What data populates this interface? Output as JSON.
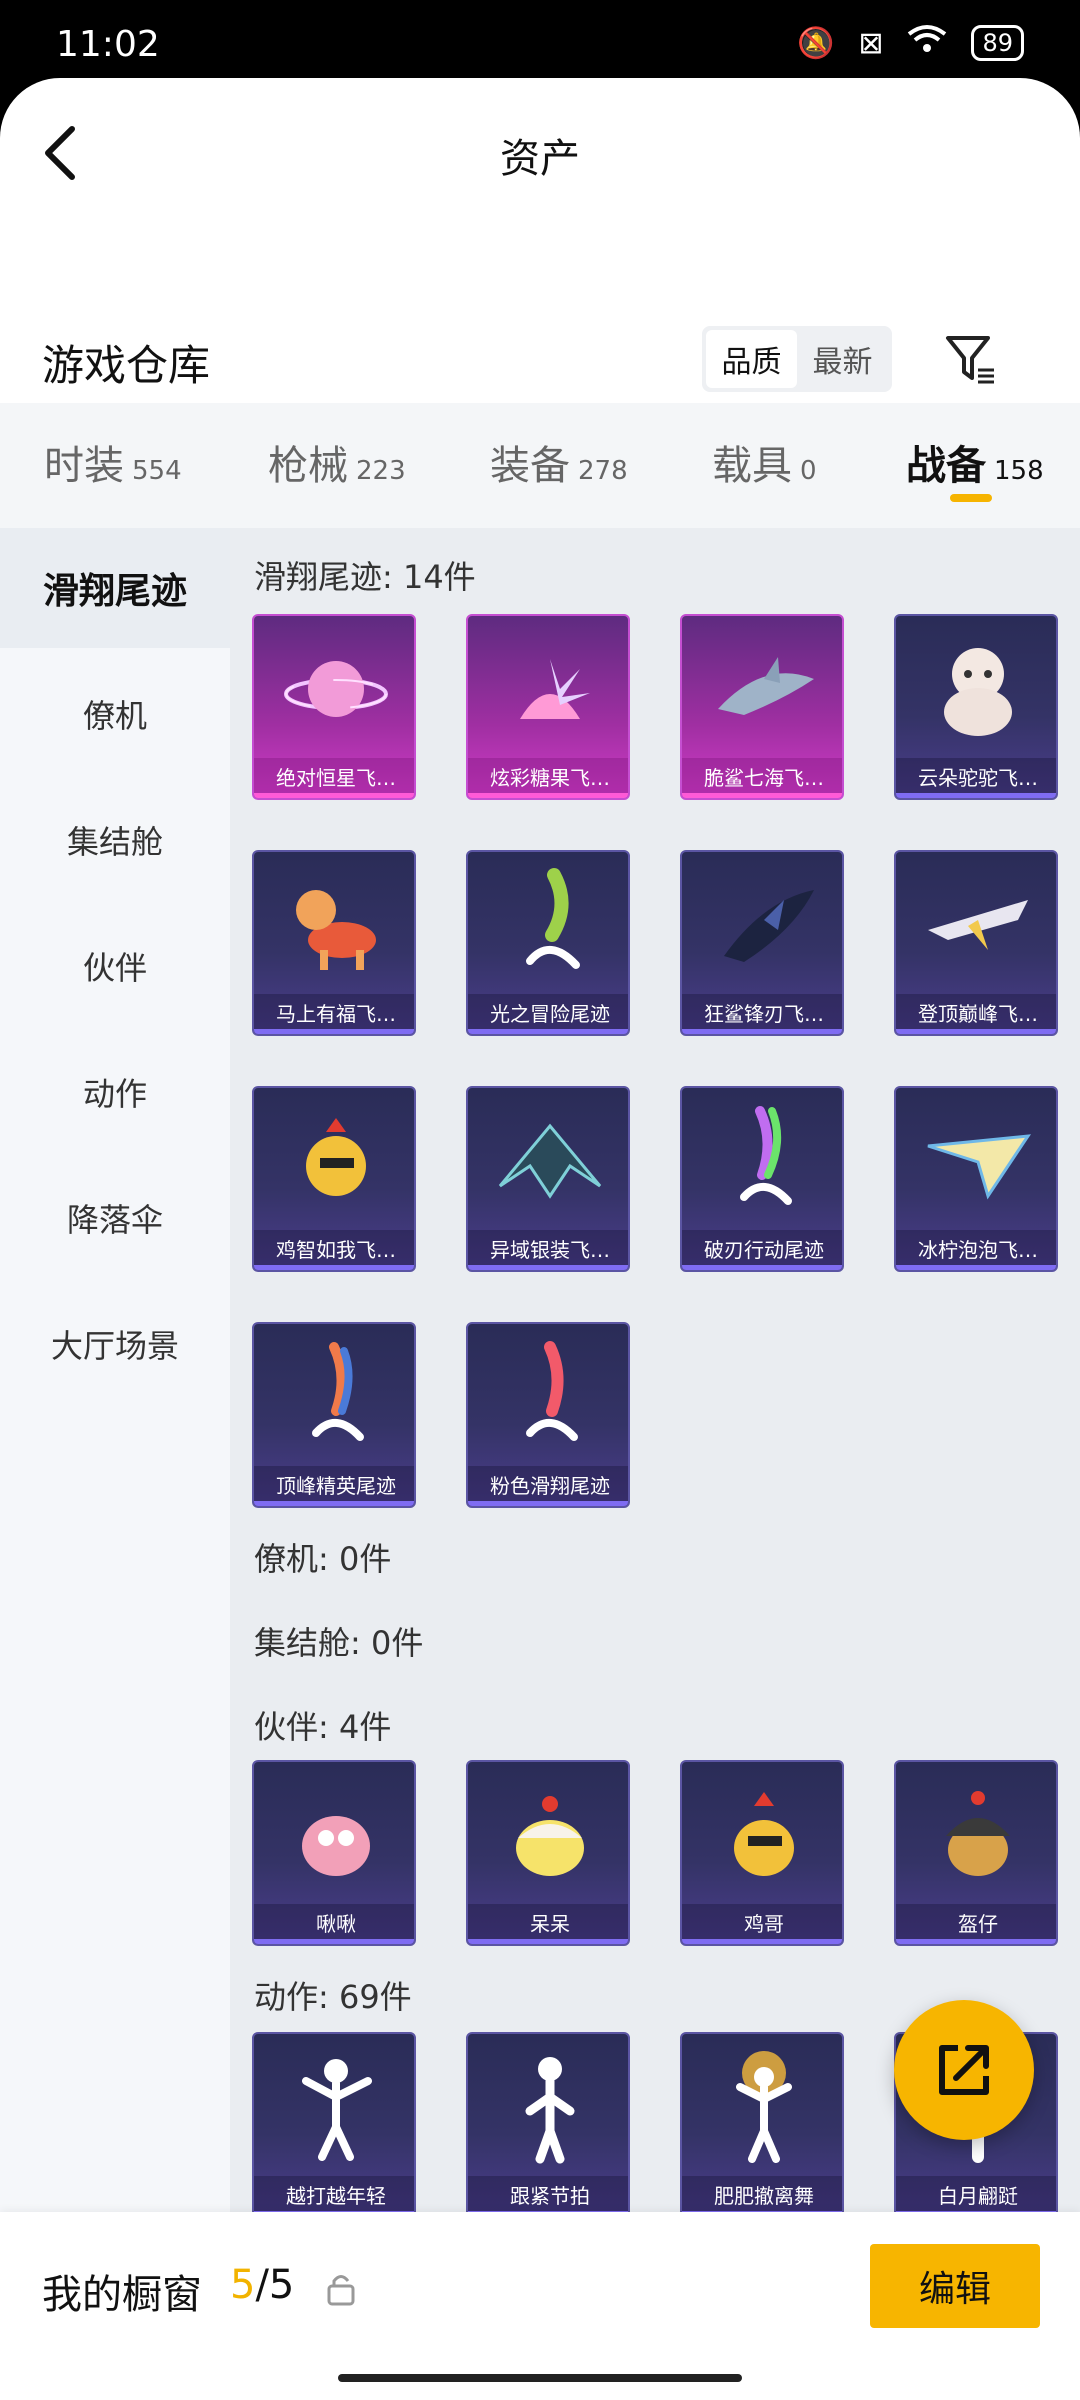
{
  "status": {
    "time": "11:02",
    "battery": "89"
  },
  "header": {
    "title": "资产"
  },
  "warehouse": {
    "title": "游戏仓库",
    "sort_options": [
      "品质",
      "最新"
    ],
    "active_sort": "品质"
  },
  "tabs": [
    {
      "label": "时装",
      "count": "554"
    },
    {
      "label": "枪械",
      "count": "223"
    },
    {
      "label": "装备",
      "count": "278"
    },
    {
      "label": "载具",
      "count": "0"
    },
    {
      "label": "战备",
      "count": "158"
    }
  ],
  "sidenav": [
    "滑翔尾迹",
    "僚机",
    "集结舱",
    "伙伴",
    "动作",
    "降落伞",
    "大厅场景"
  ],
  "sections": {
    "glide": {
      "label": "滑翔尾迹: 14件",
      "items": [
        "绝对恒星飞…",
        "炫彩糖果飞…",
        "脆鲨七海飞…",
        "云朵驼驼飞…",
        "马上有福飞…",
        "光之冒险尾迹",
        "狂鲨锋刃飞…",
        "登顶巅峰飞…",
        "鸡智如我飞…",
        "异域银装飞…",
        "破刃行动尾迹",
        "冰柠泡泡飞…",
        "顶峰精英尾迹",
        "粉色滑翔尾迹"
      ]
    },
    "wingman": {
      "label": "僚机: 0件"
    },
    "pod": {
      "label": "集结舱: 0件"
    },
    "partner": {
      "label": "伙伴: 4件",
      "items": [
        "啾啾",
        "呆呆",
        "鸡哥",
        "盔仔"
      ]
    },
    "emote": {
      "label": "动作: 69件",
      "items": [
        "越打越年轻",
        "跟紧节拍",
        "肥肥撤离舞",
        "白月翩跹"
      ]
    }
  },
  "bottom": {
    "title": "我的橱窗",
    "current": "5",
    "total": "/5",
    "edit": "编辑"
  }
}
